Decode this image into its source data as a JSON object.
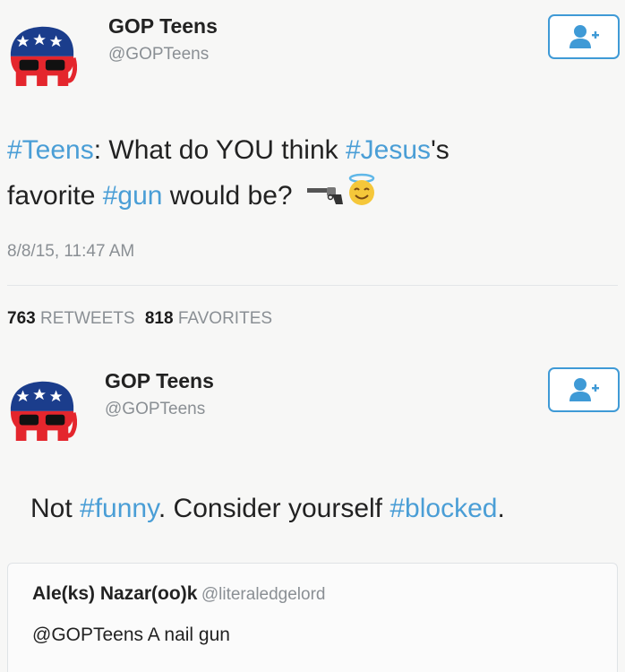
{
  "tweet1": {
    "name": "GOP Teens",
    "handle": "@GOPTeens",
    "text": {
      "l1_tag1": "#Teens",
      "l1_rest": ": What do YOU think ",
      "l1_tag2": "#Jesus",
      "l1_end": "'s",
      "l2_start": "favorite ",
      "l2_tag": "#gun",
      "l2_end": " would be?"
    },
    "emoji": [
      "gun-icon",
      "halo-smile-emoji"
    ],
    "timestamp": "8/8/15, 11:47 AM",
    "stats": {
      "retweets_count": "763",
      "retweets_label": "RETWEETS",
      "favorites_count": "818",
      "favorites_label": "FAVORITES"
    }
  },
  "tweet2": {
    "name": "GOP Teens",
    "handle": "@GOPTeens",
    "text": {
      "start": "Not ",
      "tag1": "#funny",
      "mid": ". Consider yourself ",
      "tag2": "#blocked",
      "end": "."
    }
  },
  "quoted": {
    "name": "Ale(ks) Nazar(oo)k",
    "handle": "@literaledgelord",
    "text": "@GOPTeens A nail gun"
  },
  "colors": {
    "hashtag": "#4a9ed6",
    "follow_border": "#3f9ad6",
    "logo_red": "#e4262d",
    "logo_blue": "#1b3d8c"
  },
  "icons": [
    "gop-elephant-logo",
    "follow-user-icon"
  ]
}
